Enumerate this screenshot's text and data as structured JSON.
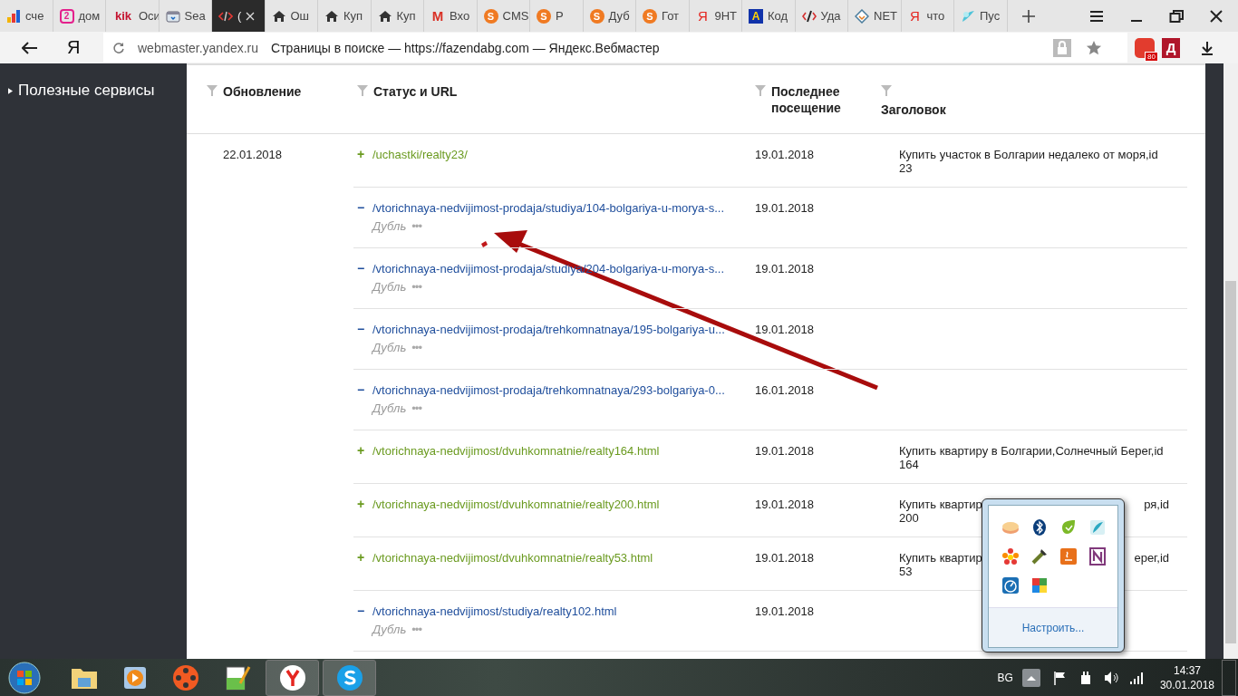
{
  "browser": {
    "tabs": [
      {
        "label": "сче",
        "kind": "bars",
        "selected": false
      },
      {
        "label": "дом",
        "kind": "circle",
        "glyph": "2",
        "selected": false
      },
      {
        "label": "Оси",
        "kind": "word",
        "glyph": "kik",
        "selected": false
      },
      {
        "label": "Sea",
        "kind": "browser",
        "selected": false
      },
      {
        "label": "(",
        "kind": "code",
        "selected": true
      },
      {
        "label": "Ош",
        "kind": "house",
        "selected": false
      },
      {
        "label": "Куп",
        "kind": "house",
        "selected": false
      },
      {
        "label": "Куп",
        "kind": "house",
        "selected": false
      },
      {
        "label": "Вхо",
        "kind": "mail",
        "glyph": "M",
        "selected": false
      },
      {
        "label": "CMS",
        "kind": "s",
        "glyph": "S",
        "selected": false
      },
      {
        "label": "P",
        "kind": "s",
        "glyph": "S",
        "selected": false
      },
      {
        "label": "Дуб",
        "kind": "s",
        "glyph": "S",
        "selected": false
      },
      {
        "label": "Гот",
        "kind": "s",
        "glyph": "S",
        "selected": false
      },
      {
        "label": "9НТ",
        "kind": "ya",
        "glyph": "Я",
        "selected": false
      },
      {
        "label": "Код",
        "kind": "a",
        "glyph": "A",
        "selected": false
      },
      {
        "label": "Уда",
        "kind": "tools",
        "selected": false
      },
      {
        "label": "NET",
        "kind": "net",
        "selected": false
      },
      {
        "label": "что",
        "kind": "ya",
        "glyph": "Я",
        "selected": false
      },
      {
        "label": "Пус",
        "kind": "bird",
        "selected": false
      }
    ],
    "logo": "Я",
    "domain": "webmaster.yandex.ru",
    "page_title": "Страницы в поиске — https://fazendabg.com — Яндекс.Вебмастер",
    "extension_badge": "80",
    "extension_letter": "Д"
  },
  "sidebar": {
    "items": [
      {
        "label": "Полезные сервисы"
      }
    ]
  },
  "table": {
    "columns": [
      "Обновление",
      "Статус и URL",
      "Последнее посещение",
      "Заголовок"
    ],
    "date": "22.01.2018",
    "rows": [
      {
        "kind": "added",
        "sign": "+",
        "url": "/uchastki/realty23/",
        "visited": "19.01.2018",
        "title": "Купить участок в Болгарии недалеко от моря,id 23"
      },
      {
        "kind": "removed",
        "sign": "−",
        "url": "/vtorichnaya-nedvijimost-prodaja/studiya/104-bolgariya-u-morya-s...",
        "reason": "Дубль",
        "more": "•••",
        "visited": "19.01.2018"
      },
      {
        "kind": "removed",
        "sign": "−",
        "url": "/vtorichnaya-nedvijimost-prodaja/studiya/204-bolgariya-u-morya-s...",
        "reason": "Дубль",
        "more": "•••",
        "visited": "19.01.2018"
      },
      {
        "kind": "removed",
        "sign": "−",
        "url": "/vtorichnaya-nedvijimost-prodaja/trehkomnatnaya/195-bolgariya-u...",
        "reason": "Дубль",
        "more": "•••",
        "visited": "19.01.2018"
      },
      {
        "kind": "removed",
        "sign": "−",
        "url": "/vtorichnaya-nedvijimost-prodaja/trehkomnatnaya/293-bolgariya-0...",
        "reason": "Дубль",
        "more": "•••",
        "visited": "16.01.2018"
      },
      {
        "kind": "added",
        "sign": "+",
        "url": "/vtorichnaya-nedvijimost/dvuhkomnatnie/realty164.html",
        "visited": "19.01.2018",
        "title": "Купить квартиру в Болгарии,Солнечный Берег,id 164"
      },
      {
        "kind": "added",
        "sign": "+",
        "url": "/vtorichnaya-nedvijimost/dvuhkomnatnie/realty200.html",
        "visited": "19.01.2018",
        "title_parts": [
          "Купить квартир",
          "ря,id",
          "200"
        ]
      },
      {
        "kind": "added",
        "sign": "+",
        "url": "/vtorichnaya-nedvijimost/dvuhkomnatnie/realty53.html",
        "visited": "19.01.2018",
        "title_parts": [
          "Купить квартир",
          "ерег,id",
          "53"
        ]
      },
      {
        "kind": "removed",
        "sign": "−",
        "url": "/vtorichnaya-nedvijimost/studiya/realty102.html",
        "reason": "Дубль",
        "more": "•••",
        "visited": "19.01.2018"
      }
    ]
  },
  "tray_popup": {
    "link": "Настроить..."
  },
  "taskbar": {
    "language": "BG",
    "time": "14:37",
    "date": "30.01.2018"
  }
}
